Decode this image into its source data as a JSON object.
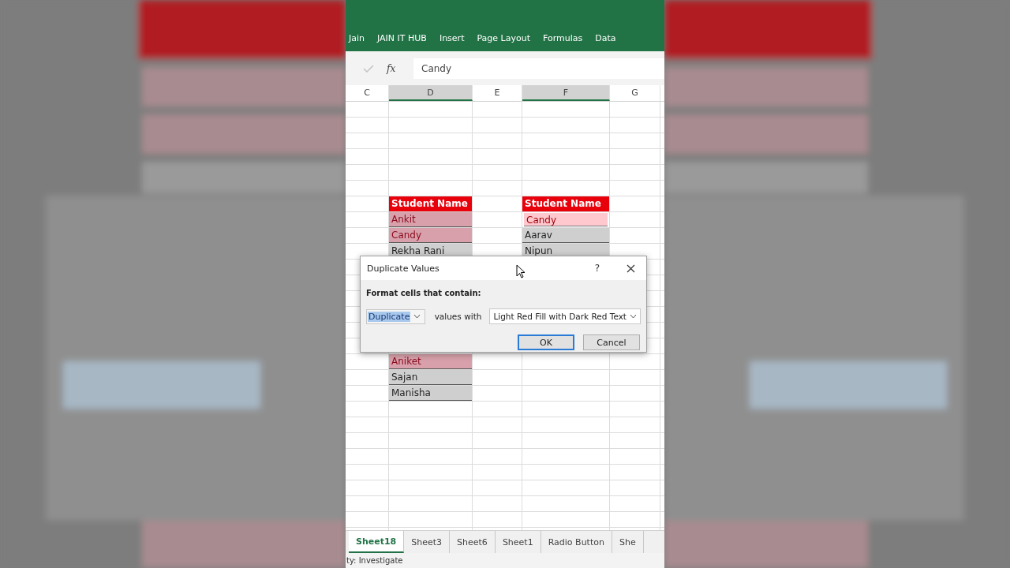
{
  "ribbon": {
    "tabs": [
      {
        "label": "Jain",
        "selected": false
      },
      {
        "label": "JAIN IT HUB",
        "selected": false
      },
      {
        "label": "Insert",
        "selected": false
      },
      {
        "label": "Page Layout",
        "selected": false
      },
      {
        "label": "Formulas",
        "selected": false
      },
      {
        "label": "Data",
        "selected": false
      }
    ]
  },
  "formula_bar": {
    "fx": "fx",
    "value": "Candy"
  },
  "column_headers": [
    {
      "label": "C",
      "selected": false
    },
    {
      "label": "D",
      "selected": true
    },
    {
      "label": "E",
      "selected": false
    },
    {
      "label": "F",
      "selected": true
    },
    {
      "label": "G",
      "selected": false
    }
  ],
  "tables": [
    {
      "header": "Student Name",
      "rows": [
        {
          "text": "Ankit",
          "duplicate": true,
          "selected": false
        },
        {
          "text": "Candy",
          "duplicate": true,
          "selected": false
        },
        {
          "text": "Rekha Rani",
          "duplicate": false,
          "selected": false
        }
      ],
      "rows_after_dialog": [
        {
          "text": "Aniket",
          "duplicate": true,
          "selected": false
        },
        {
          "text": "Sajan",
          "duplicate": false,
          "selected": false
        },
        {
          "text": "Manisha",
          "duplicate": false,
          "selected": false
        }
      ]
    },
    {
      "header": "Student Name",
      "rows": [
        {
          "text": "Candy",
          "duplicate": true,
          "selected": true
        },
        {
          "text": "Aarav",
          "duplicate": false,
          "selected": false
        },
        {
          "text": "Nipun",
          "duplicate": false,
          "selected": false
        }
      ]
    }
  ],
  "dialog": {
    "title": "Duplicate Values",
    "help": "?",
    "prompt": "Format cells that contain:",
    "type_value": "Duplicate",
    "values_with": "values with",
    "format_value": "Light Red Fill with Dark Red Text",
    "buttons": [
      {
        "label": "OK",
        "default": true
      },
      {
        "label": "Cancel",
        "default": false
      }
    ]
  },
  "sheet_tabs": [
    {
      "label": "Sheet18",
      "selected": true
    },
    {
      "label": "Sheet3",
      "selected": false
    },
    {
      "label": "Sheet6",
      "selected": false
    },
    {
      "label": "Sheet1",
      "selected": false
    },
    {
      "label": "Radio Button",
      "selected": false
    },
    {
      "label": "She",
      "selected": false
    }
  ],
  "status_bar": {
    "text": "ty: Investigate"
  }
}
